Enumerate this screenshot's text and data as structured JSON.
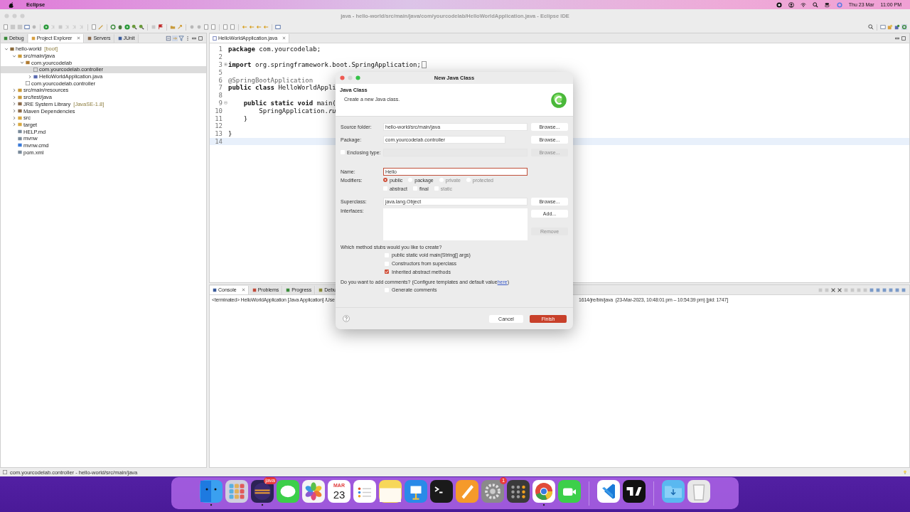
{
  "menubar": {
    "app": "Eclipse",
    "date": "Thu 23 Mar",
    "time": "11:00 PM"
  },
  "window": {
    "title": "java - hello-world/src/main/java/com/yourcodelab/HelloWorldApplication.java - Eclipse IDE"
  },
  "left_panel": {
    "tabs": [
      {
        "label": "Debug",
        "selected": false,
        "kind": "debug"
      },
      {
        "label": "Project Explorer",
        "selected": true,
        "kind": "explorer"
      },
      {
        "label": "Servers",
        "selected": false,
        "kind": "servers"
      },
      {
        "label": "JUnit",
        "selected": false,
        "kind": "junit"
      }
    ],
    "tree": [
      {
        "label": "hello-world",
        "decoration": "[boot]",
        "kind": "project",
        "expanded": true,
        "selected": false,
        "children": [
          {
            "label": "src/main/java",
            "kind": "source",
            "expanded": true,
            "selected": false,
            "children": [
              {
                "label": "com.yourcodelab",
                "kind": "package",
                "expanded": true,
                "selected": false,
                "children": [
                  {
                    "label": "com.yourcodelab.controller",
                    "kind": "empty-package",
                    "selected": true
                  },
                  {
                    "label": "HelloWorldApplication.java",
                    "kind": "java",
                    "expanded": false,
                    "selected": false
                  }
                ]
              },
              {
                "label": "com.yourcodelab.controller",
                "kind": "empty-package",
                "selected": false
              }
            ]
          },
          {
            "label": "src/main/resources",
            "kind": "source",
            "expanded": false,
            "selected": false
          },
          {
            "label": "src/test/java",
            "kind": "source",
            "expanded": false,
            "selected": false
          },
          {
            "label": "JRE System Library",
            "decoration": "[JavaSE-1.8]",
            "kind": "library",
            "expanded": false,
            "selected": false
          },
          {
            "label": "Maven Dependencies",
            "kind": "library",
            "expanded": false,
            "selected": false
          },
          {
            "label": "src",
            "kind": "folder",
            "expanded": false,
            "selected": false
          },
          {
            "label": "target",
            "kind": "folder",
            "expanded": false,
            "selected": false
          },
          {
            "label": "HELP.md",
            "kind": "file",
            "selected": false
          },
          {
            "label": "mvnw",
            "kind": "file",
            "selected": false
          },
          {
            "label": "mvnw.cmd",
            "kind": "cmd",
            "selected": false
          },
          {
            "label": "pom.xml",
            "kind": "file",
            "selected": false
          }
        ]
      }
    ]
  },
  "editor": {
    "tab": "HelloWorldApplication.java",
    "lines": [
      {
        "number": "1",
        "code": "**package** com.yourcodelab;",
        "current": false
      },
      {
        "number": "2",
        "current": false
      },
      {
        "number": "3",
        "code": "**import** org.springframework.boot.SpringApplication;",
        "collapsed": true,
        "current": false
      },
      {
        "number": "5",
        "current": false
      },
      {
        "number": "6",
        "code": "@SpringBootApplication",
        "kind": "annotation",
        "current": false
      },
      {
        "number": "7",
        "code": "**public class** HelloWorldAppli",
        "current": false
      },
      {
        "number": "8",
        "current": false
      },
      {
        "number": "9",
        "code": "    **public static void** main(",
        "collapsed": false,
        "current": false
      },
      {
        "number": "10",
        "code": "        SpringApplication.*ru*",
        "current": false
      },
      {
        "number": "11",
        "code": "    }",
        "current": false
      },
      {
        "number": "12",
        "current": false
      },
      {
        "number": "13",
        "code": "}",
        "current": false
      },
      {
        "number": "14",
        "current": true
      }
    ]
  },
  "console": {
    "tabs": [
      {
        "label": "Console",
        "selected": true,
        "kind": "console"
      },
      {
        "label": "Problems",
        "selected": false,
        "kind": "problems"
      },
      {
        "label": "Progress",
        "selected": false,
        "kind": "progress"
      },
      {
        "label": "Debu",
        "selected": false,
        "kind": "debug"
      }
    ],
    "line_start": "<terminated> HelloWorldApplication [Java Application] /Use",
    "line_end": "1614/jre/bin/java  (23-Mar-2023, 10:48:01 pm – 10:54:39 pm) [pid: 1747]"
  },
  "status_bar": "com.yourcodelab.controller - hello-world/src/main/java",
  "dialog": {
    "title": "New Java Class",
    "heading": "Java Class",
    "description": "Create a new Java class.",
    "fields": [
      {
        "label": "Source folder:",
        "value": "hello-world/src/main/java",
        "button": "Browse...",
        "disabled": false,
        "kind": "text"
      },
      {
        "label": "Package:",
        "value": "com.yourcodelab.controller",
        "button": "Browse...",
        "disabled": false,
        "kind": "text"
      },
      {
        "label": "Enclosing type:",
        "button": "Browse...",
        "disabled": true,
        "kind": "check",
        "checked": false
      }
    ],
    "name": {
      "label": "Name:",
      "value": "Hello"
    },
    "modifiers": {
      "label": "Modifiers:",
      "access": [
        {
          "label": "public",
          "selected": true,
          "disabled": false
        },
        {
          "label": "package",
          "selected": false,
          "disabled": false
        },
        {
          "label": "private",
          "selected": false,
          "disabled": true
        },
        {
          "label": "protected",
          "selected": false,
          "disabled": true
        }
      ],
      "flags": [
        {
          "label": "abstract",
          "checked": false,
          "disabled": false
        },
        {
          "label": "final",
          "checked": false,
          "disabled": false
        },
        {
          "label": "static",
          "checked": false,
          "disabled": true
        }
      ]
    },
    "superclass": {
      "label": "Superclass:",
      "value": "java.lang.Object",
      "button": "Browse..."
    },
    "interfaces": {
      "label": "Interfaces:",
      "buttons": [
        {
          "label": "Add...",
          "disabled": false
        },
        {
          "label": "Remove",
          "disabled": true
        }
      ]
    },
    "stubs": {
      "question": "Which method stubs would you like to create?",
      "options": [
        {
          "label": "public static void main(String[] args)",
          "checked": false
        },
        {
          "label": "Constructors from superclass",
          "checked": false
        },
        {
          "label": "Inherited abstract methods",
          "checked": true
        }
      ]
    },
    "comments": {
      "question_before": "Do you want to add comments? (Configure templates and default value ",
      "link": "here",
      "question_after": ")",
      "options": [
        {
          "label": "Generate comments",
          "checked": false
        }
      ]
    },
    "buttons": [
      {
        "label": "Cancel",
        "kind": "secondary"
      },
      {
        "label": "Finish",
        "kind": "primary"
      }
    ]
  },
  "dock": {
    "apps": [
      {
        "kind": "finder",
        "running": true
      },
      {
        "kind": "launchpad",
        "running": false
      },
      {
        "kind": "eclipse",
        "running": true,
        "badge": "java"
      },
      {
        "kind": "messages",
        "running": false
      },
      {
        "kind": "photos",
        "running": false
      },
      {
        "kind": "calendar",
        "running": false,
        "month": "MAR",
        "day": "23"
      },
      {
        "kind": "reminders",
        "running": false
      },
      {
        "kind": "notes",
        "running": false
      },
      {
        "kind": "keynote",
        "running": false
      },
      {
        "kind": "terminal",
        "running": false
      },
      {
        "kind": "pen",
        "running": false
      },
      {
        "kind": "settings",
        "running": false,
        "badge": "1"
      },
      {
        "kind": "calculator",
        "running": false
      },
      {
        "kind": "chrome",
        "running": true
      },
      {
        "kind": "facetime",
        "running": false
      }
    ],
    "recent": [
      {
        "kind": "vscode",
        "running": false
      },
      {
        "kind": "tradingview",
        "running": false
      }
    ],
    "stacks": [
      {
        "kind": "downloads"
      },
      {
        "kind": "trash"
      }
    ]
  }
}
